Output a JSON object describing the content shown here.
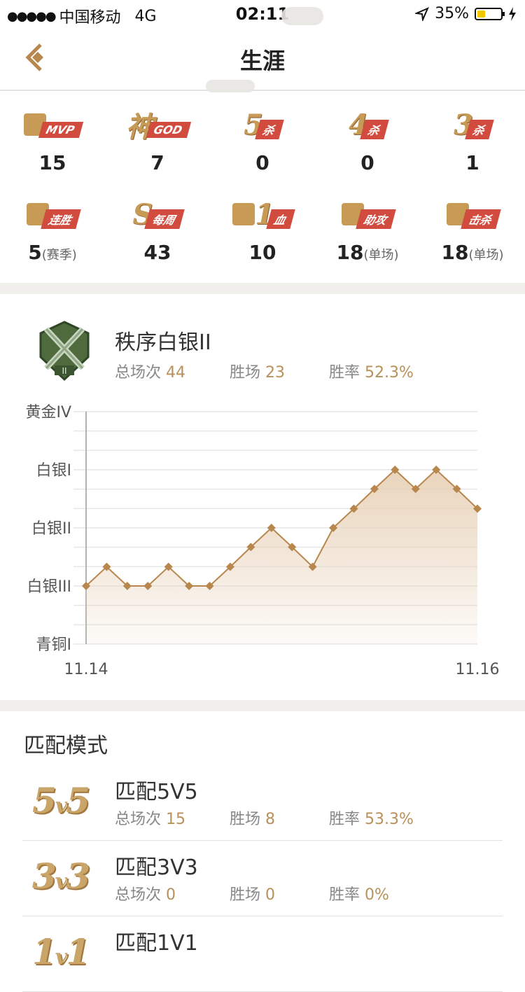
{
  "status_bar": {
    "signal_dots": "●●●●●",
    "carrier": "中国移动",
    "network": "4G",
    "time": "02:11",
    "battery": "35%",
    "battery_level": 0.35
  },
  "navbar": {
    "title": "生涯"
  },
  "stats": [
    {
      "badge_big": "",
      "ribbon": "MVP",
      "icon": "trophy-icon",
      "value": "15",
      "unit": ""
    },
    {
      "badge_big": "神",
      "ribbon": "GOD",
      "icon": "",
      "value": "7",
      "unit": ""
    },
    {
      "badge_big": "5",
      "ribbon": "杀",
      "icon": "",
      "value": "0",
      "unit": ""
    },
    {
      "badge_big": "4",
      "ribbon": "杀",
      "icon": "",
      "value": "0",
      "unit": ""
    },
    {
      "badge_big": "3",
      "ribbon": "杀",
      "icon": "",
      "value": "1",
      "unit": ""
    },
    {
      "badge_big": "",
      "ribbon": "连胜",
      "icon": "flag-icon",
      "value": "5",
      "unit": "(赛季)"
    },
    {
      "badge_big": "S",
      "ribbon": "每周",
      "icon": "",
      "value": "43",
      "unit": ""
    },
    {
      "badge_big": "1",
      "ribbon": "血",
      "icon": "blood-drop-icon",
      "value": "10",
      "unit": ""
    },
    {
      "badge_big": "",
      "ribbon": "助攻",
      "icon": "fist-icon",
      "value": "18",
      "unit": "(单场)"
    },
    {
      "badge_big": "",
      "ribbon": "击杀",
      "icon": "sword-icon",
      "value": "18",
      "unit": "(单场)"
    }
  ],
  "rank": {
    "title": "秩序白银II",
    "total_label": "总场次",
    "total": "44",
    "wins_label": "胜场",
    "wins": "23",
    "rate_label": "胜率",
    "rate": "52.3%"
  },
  "chart_data": {
    "type": "area",
    "y_levels": [
      "青铜I",
      "白银III",
      "白银II",
      "白银I",
      "黄金IV"
    ],
    "x_labels": [
      "11.14",
      "11.16"
    ],
    "values": [
      1,
      1.33,
      1,
      1,
      1.33,
      1,
      1,
      1.33,
      1.67,
      2,
      1.67,
      1.33,
      2,
      2.33,
      2.67,
      3,
      2.67,
      3,
      2.67,
      2.33
    ],
    "ylim": [
      0,
      4
    ],
    "line_color": "#b8874e",
    "fill_color": "#e8d2b8"
  },
  "modes": {
    "title": "匹配模式",
    "items": [
      {
        "logo_left": "5",
        "logo_v": "v",
        "logo_right": "5",
        "name": "匹配5V5",
        "total_label": "总场次",
        "total": "15",
        "wins_label": "胜场",
        "wins": "8",
        "rate_label": "胜率",
        "rate": "53.3%"
      },
      {
        "logo_left": "3",
        "logo_v": "v",
        "logo_right": "3",
        "name": "匹配3V3",
        "total_label": "总场次",
        "total": "0",
        "wins_label": "胜场",
        "wins": "0",
        "rate_label": "胜率",
        "rate": "0%"
      },
      {
        "logo_left": "1",
        "logo_v": "v",
        "logo_right": "1",
        "name": "匹配1V1",
        "total_label": "",
        "total": "",
        "wins_label": "",
        "wins": "",
        "rate_label": "",
        "rate": ""
      }
    ]
  },
  "colors": {
    "accent": "#b8915a",
    "ribbon": "#d24b3f",
    "gold": "#c79a55"
  }
}
